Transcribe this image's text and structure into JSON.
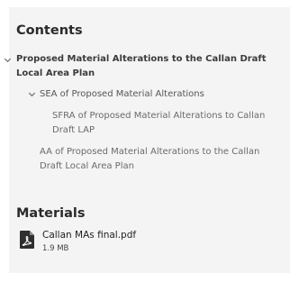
{
  "contents": {
    "heading": "Contents",
    "items": [
      {
        "label": "Proposed Material Alterations to the Callan Draft Local Area Plan"
      },
      {
        "label": "SEA of Proposed Material Alterations"
      },
      {
        "label": "SFRA of Proposed Material Alterations to Callan Draft LAP"
      },
      {
        "label": "AA of Proposed Material Alterations to the Callan Draft Local Area Plan"
      }
    ]
  },
  "materials": {
    "heading": "Materials",
    "files": [
      {
        "name": "Callan MAs final.pdf",
        "size": "1.9 MB",
        "icon": "pdf-file-icon"
      }
    ]
  }
}
